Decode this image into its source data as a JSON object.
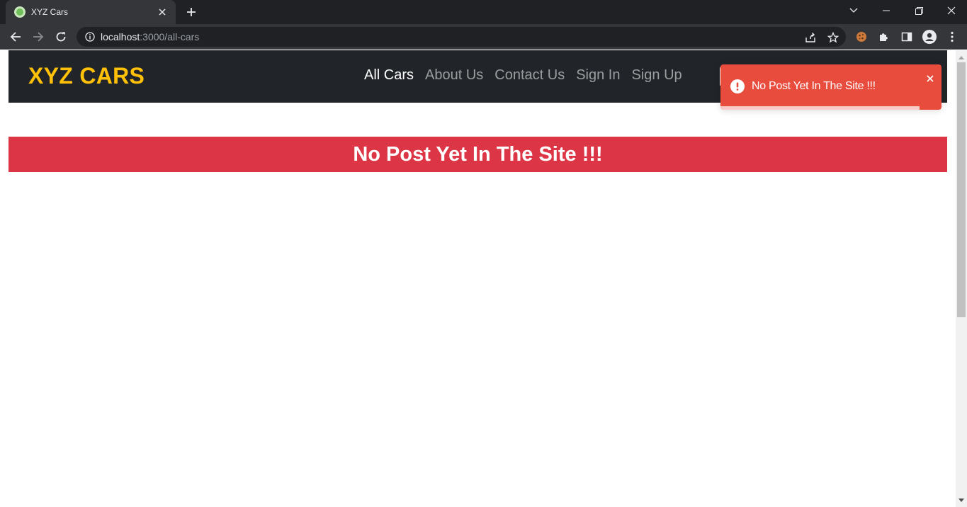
{
  "browser": {
    "tab_title": "XYZ Cars",
    "url_host": "localhost",
    "url_path": ":3000/all-cars"
  },
  "site": {
    "brand": "XYZ CARS",
    "nav": [
      {
        "label": "All Cars",
        "active": true
      },
      {
        "label": "About Us",
        "active": false
      },
      {
        "label": "Contact Us",
        "active": false
      },
      {
        "label": "Sign In",
        "active": false
      },
      {
        "label": "Sign Up",
        "active": false
      }
    ],
    "empty_message": "No Post Yet In The Site !!!"
  },
  "toast": {
    "message": "No Post Yet In The Site !!!",
    "progress_fraction": 0.9
  },
  "colors": {
    "brand": "#ffc107",
    "navbar": "#212529",
    "banner": "#dc3545",
    "toast": "#e74c3c"
  },
  "icons": {
    "tab_favicon": "green-circle-icon",
    "toast": "exclamation-circle-icon"
  }
}
